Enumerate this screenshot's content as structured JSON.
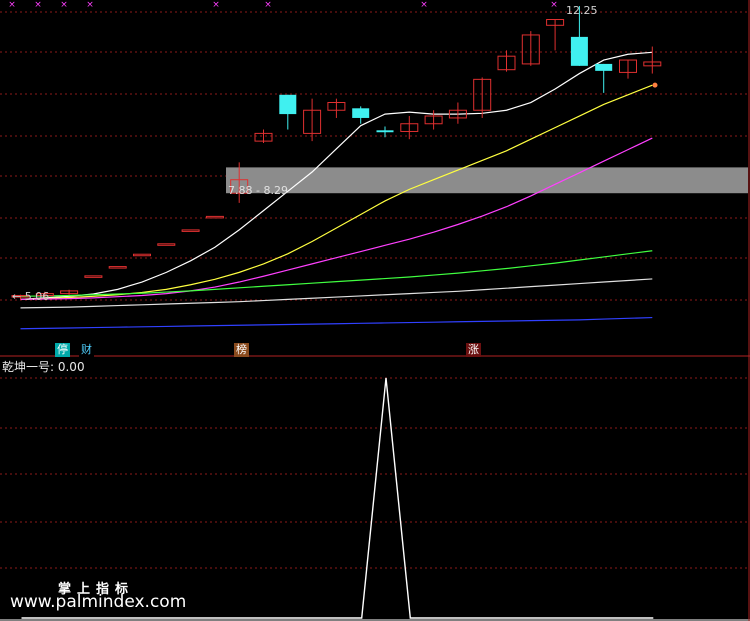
{
  "indicator": {
    "title": "乾坤一号",
    "value_label": "乾坤一号: 0.00"
  },
  "watermark": {
    "brand": "掌上指标",
    "site": "www.palmindex.com"
  },
  "annotations": {
    "low": "5.06",
    "high": "12.25",
    "range_text": "7.88 - 8.29"
  },
  "badges": [
    {
      "text": "停",
      "bg": "#00aaaa",
      "color": "#ffffff"
    },
    {
      "text": "财",
      "bg": "#000000",
      "color": "#4fd0ff"
    },
    {
      "text": "榜",
      "bg": "#8a4b1e",
      "color": "#ffffff"
    },
    {
      "text": "涨",
      "bg": "#6b1010",
      "color": "#ffffff"
    }
  ],
  "colors": {
    "up": "#e03030",
    "down": "#40f0f0",
    "grid": "#8b1a1a",
    "divider": "#b22222",
    "ma5": "#ffffff",
    "ma10": "#ffff40",
    "ma20": "#ff40ff",
    "ma60": "#40ff40",
    "ma120": "#e0e0e0",
    "ma250": "#3040ff",
    "zone": "#8c8c8c"
  },
  "chart_data": [
    {
      "type": "candlestick",
      "title": "",
      "y_range": [
        4.0,
        12.6
      ],
      "x_count": 27,
      "zone_band": [
        7.88,
        8.29
      ],
      "ohlc": [
        [
          5.06,
          5.12,
          4.98,
          5.1
        ],
        [
          5.1,
          5.2,
          5.06,
          5.15
        ],
        [
          5.15,
          5.25,
          5.12,
          5.22
        ],
        [
          5.61,
          5.61,
          5.61,
          5.61
        ],
        [
          5.85,
          5.85,
          5.85,
          5.85
        ],
        [
          6.17,
          6.17,
          6.17,
          6.17
        ],
        [
          6.44,
          6.44,
          6.44,
          6.44
        ],
        [
          6.8,
          6.8,
          6.8,
          6.8
        ],
        [
          7.15,
          7.15,
          7.15,
          7.15
        ],
        [
          7.75,
          8.55,
          7.5,
          8.1
        ],
        [
          9.1,
          9.4,
          9.05,
          9.3
        ],
        [
          10.3,
          10.3,
          9.4,
          9.8
        ],
        [
          9.3,
          10.2,
          9.1,
          9.9
        ],
        [
          9.9,
          10.2,
          9.7,
          10.1
        ],
        [
          9.95,
          10.0,
          9.55,
          9.7
        ],
        [
          9.38,
          9.48,
          9.2,
          9.33
        ],
        [
          9.35,
          9.75,
          9.15,
          9.55
        ],
        [
          9.55,
          9.9,
          9.4,
          9.75
        ],
        [
          9.7,
          10.1,
          9.55,
          9.9
        ],
        [
          9.9,
          10.75,
          9.7,
          10.7
        ],
        [
          10.95,
          11.45,
          10.9,
          11.3
        ],
        [
          11.1,
          11.95,
          11.05,
          11.85
        ],
        [
          12.1,
          12.25,
          11.45,
          12.25
        ],
        [
          11.8,
          12.6,
          11.05,
          11.05
        ],
        [
          11.1,
          11.1,
          10.35,
          10.92
        ],
        [
          10.88,
          11.2,
          10.72,
          11.2
        ],
        [
          11.05,
          11.55,
          10.85,
          11.15
        ]
      ],
      "series": [
        {
          "key": "ma5",
          "values": [
            5.0,
            5.04,
            5.08,
            5.14,
            5.26,
            5.45,
            5.7,
            6.0,
            6.35,
            6.8,
            7.3,
            7.8,
            8.3,
            8.9,
            9.5,
            9.8,
            9.85,
            9.8,
            9.8,
            9.82,
            9.9,
            10.1,
            10.45,
            10.85,
            11.2,
            11.35,
            11.4
          ]
        },
        {
          "key": "ma10",
          "values": [
            5.0,
            5.02,
            5.05,
            5.08,
            5.12,
            5.18,
            5.26,
            5.38,
            5.52,
            5.7,
            5.92,
            6.18,
            6.5,
            6.85,
            7.2,
            7.55,
            7.85,
            8.1,
            8.35,
            8.6,
            8.85,
            9.15,
            9.45,
            9.75,
            10.05,
            10.3,
            10.55
          ]
        },
        {
          "key": "ma20",
          "values": [
            5.0,
            5.01,
            5.02,
            5.04,
            5.07,
            5.1,
            5.15,
            5.22,
            5.32,
            5.45,
            5.6,
            5.76,
            5.92,
            6.08,
            6.24,
            6.4,
            6.56,
            6.74,
            6.94,
            7.16,
            7.4,
            7.68,
            7.98,
            8.28,
            8.58,
            8.88,
            9.18
          ]
        },
        {
          "key": "ma60",
          "values": [
            5.08,
            5.09,
            5.1,
            5.12,
            5.14,
            5.16,
            5.19,
            5.22,
            5.26,
            5.3,
            5.34,
            5.38,
            5.42,
            5.46,
            5.5,
            5.54,
            5.58,
            5.63,
            5.68,
            5.74,
            5.8,
            5.87,
            5.94,
            6.02,
            6.1,
            6.18,
            6.26
          ]
        },
        {
          "key": "ma120",
          "values": [
            4.78,
            4.79,
            4.8,
            4.82,
            4.84,
            4.86,
            4.88,
            4.9,
            4.92,
            4.94,
            4.97,
            5.0,
            5.03,
            5.06,
            5.09,
            5.12,
            5.15,
            5.18,
            5.21,
            5.25,
            5.29,
            5.33,
            5.37,
            5.41,
            5.45,
            5.49,
            5.53
          ]
        },
        {
          "key": "ma250",
          "values": [
            4.24,
            4.25,
            4.26,
            4.27,
            4.28,
            4.29,
            4.3,
            4.31,
            4.32,
            4.33,
            4.34,
            4.35,
            4.36,
            4.37,
            4.38,
            4.39,
            4.4,
            4.41,
            4.42,
            4.43,
            4.44,
            4.45,
            4.46,
            4.47,
            4.49,
            4.51,
            4.53
          ]
        }
      ]
    },
    {
      "type": "line",
      "title": "乾坤一号",
      "y_range": [
        0,
        1
      ],
      "values": [
        0,
        0,
        0,
        0,
        0,
        0,
        0,
        0,
        0,
        0,
        0,
        0,
        0,
        0,
        0,
        1,
        0,
        0,
        0,
        0,
        0,
        0,
        0,
        0,
        0,
        0,
        0
      ]
    }
  ]
}
